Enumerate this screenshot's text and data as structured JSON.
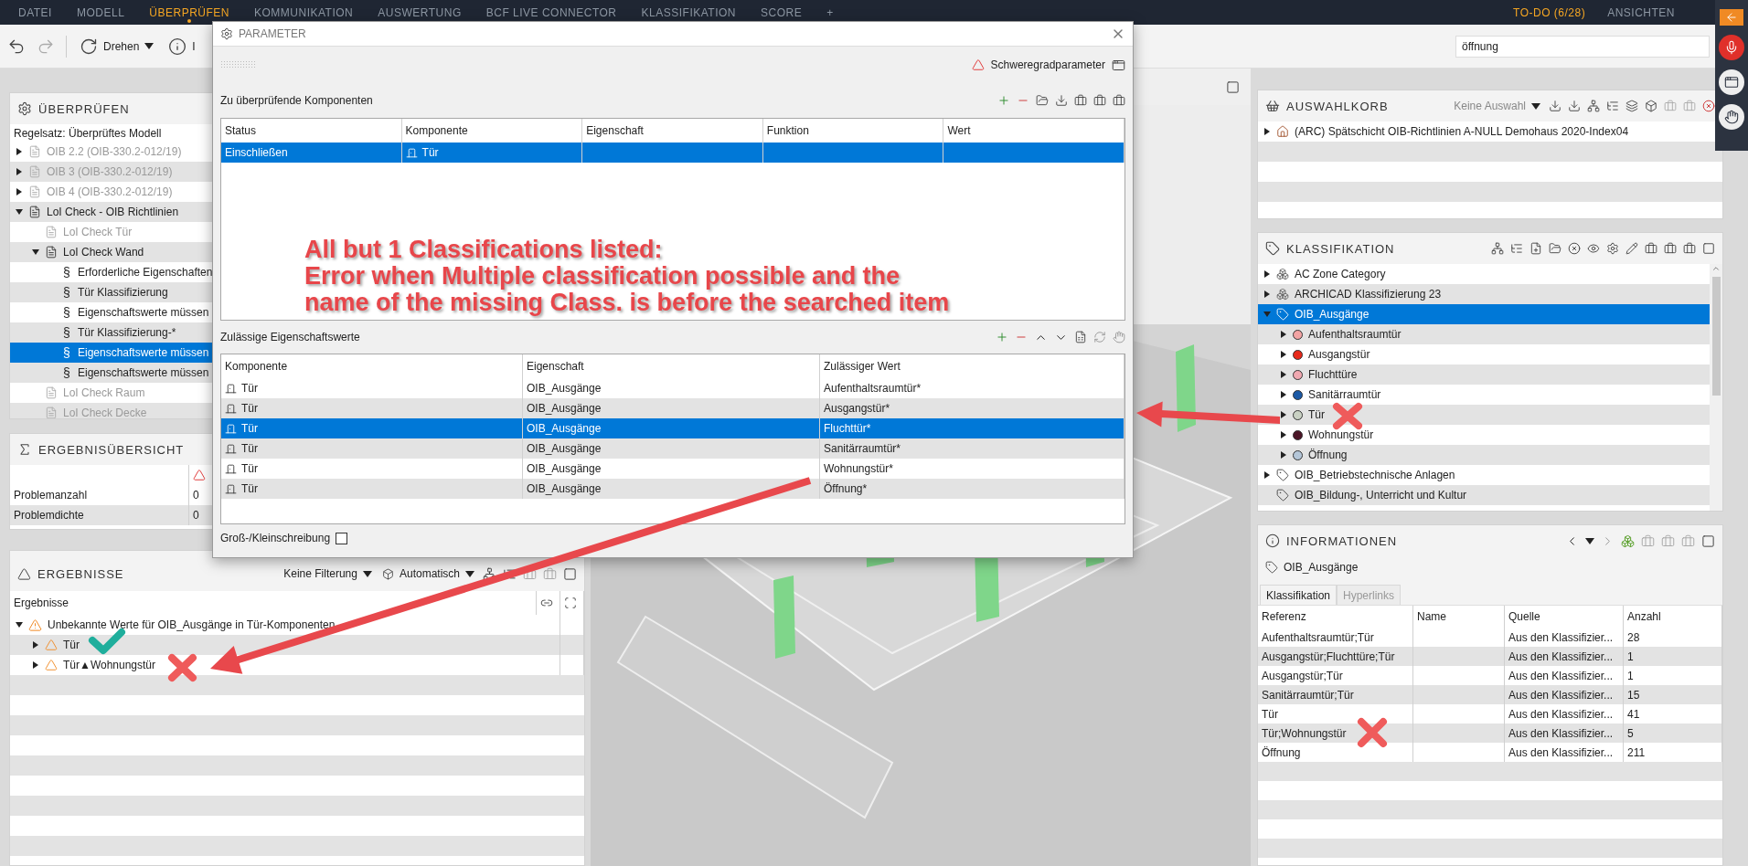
{
  "menu": {
    "items": [
      {
        "label": "DATEI",
        "selected": false
      },
      {
        "label": "MODELL",
        "selected": false
      },
      {
        "label": "ÜBERPRÜFEN",
        "selected": true
      },
      {
        "label": "KOMMUNIKATION",
        "selected": false
      },
      {
        "label": "AUSWERTUNG",
        "selected": false
      },
      {
        "label": "BCF LIVE CONNECTOR",
        "selected": false
      },
      {
        "label": "KLASSIFIKATION",
        "selected": false
      },
      {
        "label": "SCORE",
        "selected": false
      }
    ],
    "add": "+",
    "todo": "TO-DO (6/28)",
    "views": "ANSICHTEN"
  },
  "toolbar": {
    "rotate": "Drehen",
    "info": "I",
    "search": {
      "value": "öffnung"
    }
  },
  "check_panel": {
    "title": "ÜBERPRÜFEN",
    "ruleset": "Regelsatz: Überprüftes Modell",
    "tree": [
      {
        "label": "OIB 2.2 (OIB-330.2-012/19)",
        "kind": "ruleset",
        "expanded": false,
        "disabled": true,
        "selected": false
      },
      {
        "label": "OIB 3 (OIB-330.2-012/19)",
        "kind": "ruleset",
        "expanded": false,
        "disabled": true,
        "selected": false
      },
      {
        "label": "OIB 4 (OIB-330.2-012/19)",
        "kind": "ruleset",
        "expanded": false,
        "disabled": true,
        "selected": false
      },
      {
        "label": "LoI Check - OIB Richtlinien",
        "kind": "ruleset",
        "expanded": true,
        "disabled": false,
        "selected": false,
        "children": [
          {
            "label": "LoI Check Tür",
            "kind": "ruleset",
            "disabled": true,
            "selected": false
          },
          {
            "label": "LoI Check Wand",
            "kind": "ruleset",
            "expanded": true,
            "disabled": false,
            "selected": false,
            "children": [
              {
                "label": "Erforderliche Eigenschaften",
                "kind": "rule",
                "marker": "§",
                "disabled": false,
                "selected": false
              },
              {
                "label": "Tür Klassifizierung",
                "kind": "rule",
                "marker": "§",
                "disabled": false,
                "selected": false
              },
              {
                "label": "Eigenschaftswerte müssen",
                "kind": "rule",
                "marker": "§",
                "disabled": false,
                "selected": false
              },
              {
                "label": "Tür Klassifizierung-*",
                "kind": "rule",
                "marker": "§",
                "disabled": false,
                "selected": false
              },
              {
                "label": "Eigenschaftswerte müssen",
                "kind": "rule",
                "marker": "§",
                "disabled": false,
                "selected": true
              },
              {
                "label": "Eigenschaftswerte müssen",
                "kind": "rule",
                "marker": "§",
                "disabled": false,
                "selected": false
              }
            ]
          },
          {
            "label": "LoI Check Raum",
            "kind": "ruleset",
            "disabled": true,
            "selected": false
          },
          {
            "label": "LoI Check Decke",
            "kind": "ruleset",
            "disabled": true,
            "selected": false
          }
        ]
      }
    ]
  },
  "summary_panel": {
    "title": "ERGEBNISÜBERSICHT",
    "rows": [
      {
        "label": "Problemanzahl",
        "value": "0"
      },
      {
        "label": "Problemdichte",
        "value": "0"
      }
    ]
  },
  "results_panel": {
    "title": "ERGEBNISSE",
    "filter": "Keine Filterung",
    "mode": "Automatisch",
    "column": "Ergebnisse",
    "tree": [
      {
        "label": "Unbekannte Werte für OIB_Ausgänge in Tür-Komponenten",
        "kind": "group",
        "expanded": true,
        "children": [
          {
            "label": "Tür",
            "kind": "issue",
            "expanded": false
          },
          {
            "label": "Tür▲Wohnungstür",
            "kind": "issue",
            "expanded": false
          }
        ]
      }
    ]
  },
  "dialog": {
    "title": "PARAMETER",
    "severity": "Schweregradparameter",
    "components": {
      "label": "Zu überprüfende Komponenten",
      "columns": [
        "Status",
        "Komponente",
        "Eigenschaft",
        "Funktion",
        "Wert"
      ],
      "rows": [
        {
          "status": "Einschließen",
          "component": "Tür",
          "selected": true
        }
      ]
    },
    "values": {
      "label": "Zulässige Eigenschaftswerte",
      "columns": [
        "Komponente",
        "Eigenschaft",
        "Zulässiger Wert"
      ],
      "rows": [
        {
          "component": "Tür",
          "property": "OIB_Ausgänge",
          "value": "Aufenthaltsraumtür*",
          "selected": false
        },
        {
          "component": "Tür",
          "property": "OIB_Ausgänge",
          "value": "Ausgangstür*",
          "selected": false
        },
        {
          "component": "Tür",
          "property": "OIB_Ausgänge",
          "value": "Fluchttür*",
          "selected": true
        },
        {
          "component": "Tür",
          "property": "OIB_Ausgänge",
          "value": "Sanitärraumtür*",
          "selected": false
        },
        {
          "component": "Tür",
          "property": "OIB_Ausgänge",
          "value": "Wohnungstür*",
          "selected": false
        },
        {
          "component": "Tür",
          "property": "OIB_Ausgänge",
          "value": "Öffnung*",
          "selected": false
        }
      ]
    },
    "case_sensitive": {
      "label": "Groß-/Kleinschreibung",
      "checked": false
    }
  },
  "selection_basket": {
    "title": "AUSWAHLKORB",
    "selection": "Keine Auswahl",
    "tree": [
      {
        "label": "(ARC) Spätschicht OIB-Richtlinien A-NULL Demohaus 2020-Index04",
        "kind": "model",
        "expanded": false,
        "selected": false
      }
    ]
  },
  "classification": {
    "title": "KLASSIFIKATION",
    "tree": [
      {
        "label": "AC Zone Category",
        "kind": "system",
        "expanded": false,
        "selected": false
      },
      {
        "label": "ARCHICAD Klassifizierung 23",
        "kind": "system",
        "expanded": false,
        "selected": false
      },
      {
        "label": "OIB_Ausgänge",
        "kind": "class",
        "expanded": true,
        "selected": true,
        "children": [
          {
            "label": "Aufenthaltsraumtür",
            "kind": "item",
            "color": "#f2a3a3",
            "expanded": false,
            "selected": false
          },
          {
            "label": "Ausgangstür",
            "kind": "item",
            "color": "#e82a1c",
            "expanded": false,
            "selected": false
          },
          {
            "label": "Fluchttüre",
            "kind": "item",
            "color": "#f0a8b0",
            "expanded": false,
            "selected": false
          },
          {
            "label": "Sanitärraumtür",
            "kind": "item",
            "color": "#1c5aa6",
            "expanded": false,
            "selected": false
          },
          {
            "label": "Tür",
            "kind": "item",
            "color": "#c9d1c3",
            "expanded": false,
            "selected": false
          },
          {
            "label": "Wohnungstür",
            "kind": "item",
            "color": "#4b1526",
            "expanded": false,
            "selected": false
          },
          {
            "label": "Öffnung",
            "kind": "item",
            "color": "#b4c6d8",
            "expanded": false,
            "selected": false
          }
        ]
      },
      {
        "label": "OIB_Betriebstechnische Anlagen",
        "kind": "class",
        "expanded": false,
        "selected": false
      },
      {
        "label": "OIB_Bildung-, Unterricht und Kultur",
        "kind": "class",
        "selected": false
      }
    ]
  },
  "information": {
    "title": "INFORMATIONEN",
    "item": "OIB_Ausgänge",
    "tabs": [
      {
        "label": "Klassifikation",
        "selected": true
      },
      {
        "label": "Hyperlinks",
        "selected": false
      }
    ],
    "columns": [
      "Referenz",
      "Name",
      "Quelle",
      "Anzahl"
    ],
    "rows": [
      {
        "reference": "Aufenthaltsraumtür;Tür",
        "source": "Aus den Klassifizier...",
        "count": "28"
      },
      {
        "reference": "Ausgangstür;Fluchttüre;Tür",
        "source": "Aus den Klassifizier...",
        "count": "1"
      },
      {
        "reference": "Ausgangstür;Tür",
        "source": "Aus den Klassifizier...",
        "count": "1"
      },
      {
        "reference": "Sanitärraumtür;Tür",
        "source": "Aus den Klassifizier...",
        "count": "15"
      },
      {
        "reference": "Tür",
        "source": "Aus den Klassifizier...",
        "count": "41"
      },
      {
        "reference": "Tür;Wohnungstür",
        "source": "Aus den Klassifizier...",
        "count": "5"
      },
      {
        "reference": "Öffnung",
        "source": "Aus den Klassifizier...",
        "count": "211"
      }
    ]
  },
  "annotation": {
    "lines": [
      "All but 1 Classifications listed:",
      "Error when Multiple classification possible and the",
      "name of the missing Class. is before the searched item"
    ]
  }
}
